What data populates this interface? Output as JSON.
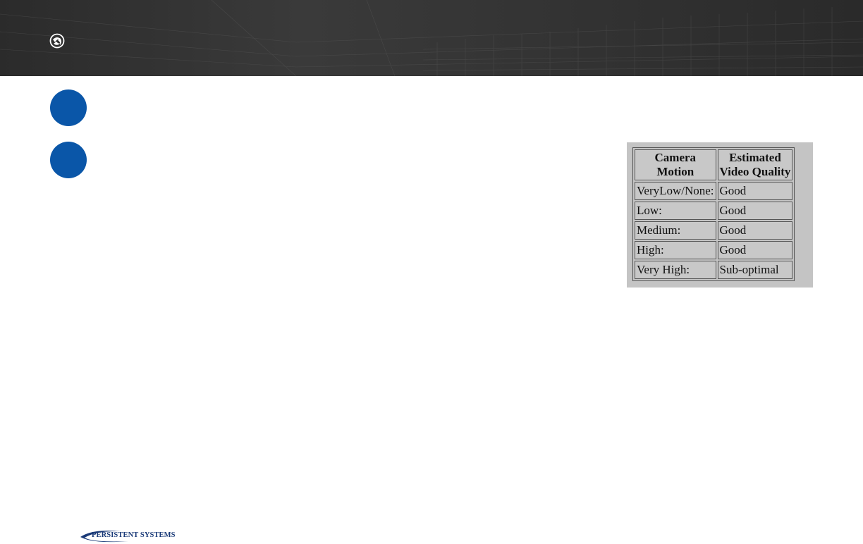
{
  "header": {
    "logo_icon": "persistent-systems-emblem-icon",
    "background_color": "#333333"
  },
  "bullets": [
    {
      "icon": "blue-circle-bullet",
      "color": "#0a56a8"
    },
    {
      "icon": "blue-circle-bullet",
      "color": "#0a56a8"
    }
  ],
  "quality_table": {
    "headers": [
      {
        "line1": "Camera",
        "line2": "Motion"
      },
      {
        "line1": "Estimated",
        "line2": "Video Quality"
      }
    ],
    "rows": [
      {
        "motion": "VeryLow/None:",
        "quality": "Good"
      },
      {
        "motion": "Low:",
        "quality": "Good"
      },
      {
        "motion": "Medium:",
        "quality": "Good"
      },
      {
        "motion": "High:",
        "quality": "Good"
      },
      {
        "motion": "Very High:",
        "quality": "Sub-optimal"
      }
    ]
  },
  "footer": {
    "brand": "PERSISTENT SYSTEMS",
    "brand_color": "#1a3a78"
  }
}
